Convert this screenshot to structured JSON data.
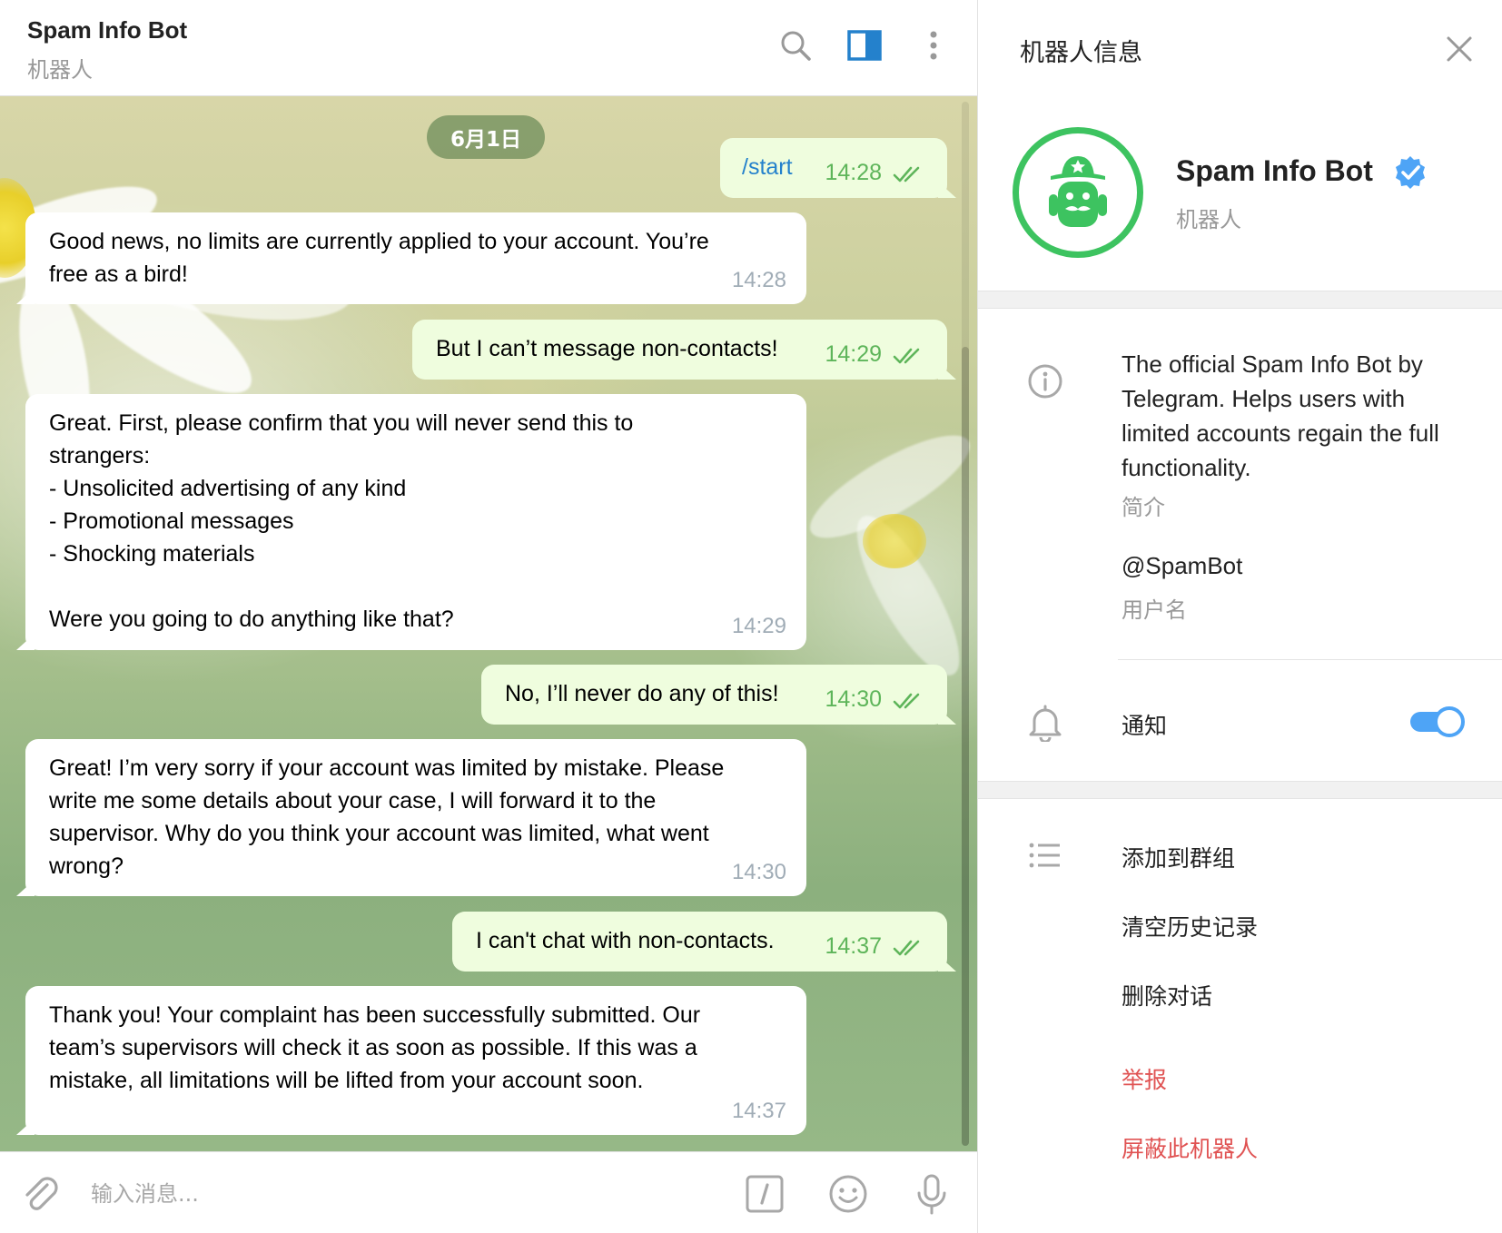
{
  "chat": {
    "title": "Spam Info Bot",
    "subtitle": "机器人",
    "date": "6月1日",
    "messages": [
      {
        "dir": "out",
        "text": "/start",
        "time": "14:28",
        "is_command": true
      },
      {
        "dir": "in",
        "text": "Good news, no limits are currently applied to your account. You’re\nfree as a bird!",
        "time": "14:28"
      },
      {
        "dir": "out",
        "text": "But I can’t message non-contacts!",
        "time": "14:29"
      },
      {
        "dir": "in",
        "text": "Great. First, please confirm that you will never send this to\nstrangers:\n- Unsolicited advertising of any kind\n- Promotional messages\n- Shocking materials\n\nWere you going to do anything like that?",
        "time": "14:29"
      },
      {
        "dir": "out",
        "text": "No, I’ll never do any of this!",
        "time": "14:30"
      },
      {
        "dir": "in",
        "text": "Great! I’m very sorry if your account was limited by mistake. Please\nwrite me some details about your case, I will forward it to the\nsupervisor. Why do you think your account was limited, what went\nwrong?",
        "time": "14:30"
      },
      {
        "dir": "out",
        "text": "I can't chat with non-contacts.",
        "time": "14:37"
      },
      {
        "dir": "in",
        "text": "Thank you! Your complaint has been successfully submitted. Our\nteam’s supervisors will check it as soon as possible. If this was a\nmistake, all limitations will be lifted from your account soon.",
        "time": "14:37"
      }
    ],
    "composer_placeholder": "输入消息..."
  },
  "panel": {
    "title": "机器人信息",
    "bot_name": "Spam Info Bot",
    "bot_sub": "机器人",
    "about": "The official Spam Info Bot by Telegram. Helps users with limited accounts regain the full functionality.",
    "about_label": "简介",
    "username": "@SpamBot",
    "username_label": "用户名",
    "notifications_label": "通知",
    "notifications_on": true,
    "actions": [
      {
        "label": "添加到群组",
        "danger": false
      },
      {
        "label": "清空历史记录",
        "danger": false
      },
      {
        "label": "删除对话",
        "danger": false
      },
      {
        "label": "举报",
        "danger": true
      },
      {
        "label": "屏蔽此机器人",
        "danger": true
      }
    ]
  },
  "colors": {
    "accent": "#2481cc",
    "outgoing_bubble": "#effdde",
    "read_check": "#5eb55a",
    "avatar_ring": "#3dc360",
    "danger": "#e05353",
    "toggle": "#4ea4f6"
  },
  "icons": {
    "header": [
      "search-icon",
      "sidebar-toggle-icon",
      "more-vertical-icon"
    ],
    "composer": [
      "paperclip-icon",
      "bot-command-icon",
      "emoji-icon",
      "microphone-icon"
    ],
    "panel": [
      "close-icon",
      "verified-icon",
      "info-icon",
      "bell-icon",
      "list-icon"
    ]
  }
}
